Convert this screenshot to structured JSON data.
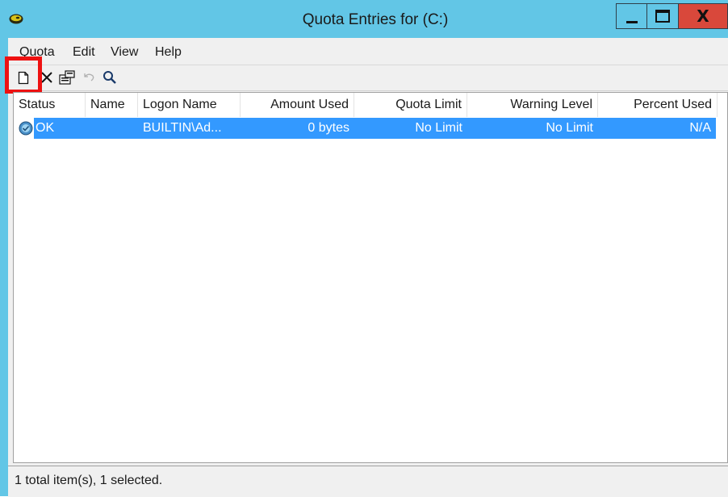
{
  "window": {
    "title": "Quota Entries for  (C:)",
    "controls": {
      "minimize_icon": "minimize-icon",
      "maximize_icon": "maximize-icon",
      "close_label": "X"
    }
  },
  "menu": {
    "items": [
      {
        "label": "Quota"
      },
      {
        "label": "Edit"
      },
      {
        "label": "View"
      },
      {
        "label": "Help"
      }
    ]
  },
  "toolbar": {
    "items": [
      {
        "icon": "new-quota-entry-icon",
        "highlighted": true
      },
      {
        "icon": "delete-icon"
      },
      {
        "icon": "properties-icon"
      },
      {
        "icon": "undo-icon",
        "disabled": true
      },
      {
        "icon": "find-icon"
      }
    ]
  },
  "table": {
    "columns": [
      "Status",
      "Name",
      "Logon Name",
      "Amount Used",
      "Quota Limit",
      "Warning Level",
      "Percent Used"
    ],
    "rows": [
      {
        "selected": true,
        "status_icon": "ok-status-icon",
        "status": "OK",
        "name": "",
        "logon_name": "BUILTIN\\Ad...",
        "amount_used": "0 bytes",
        "quota_limit": "No Limit",
        "warning_level": "No Limit",
        "percent_used": "N/A"
      }
    ]
  },
  "statusbar": {
    "text": "1 total item(s), 1 selected."
  },
  "colors": {
    "titlebar": "#62c6e6",
    "close_button": "#d9483b",
    "selection": "#3399ff",
    "highlight_box": "#ee1111"
  }
}
